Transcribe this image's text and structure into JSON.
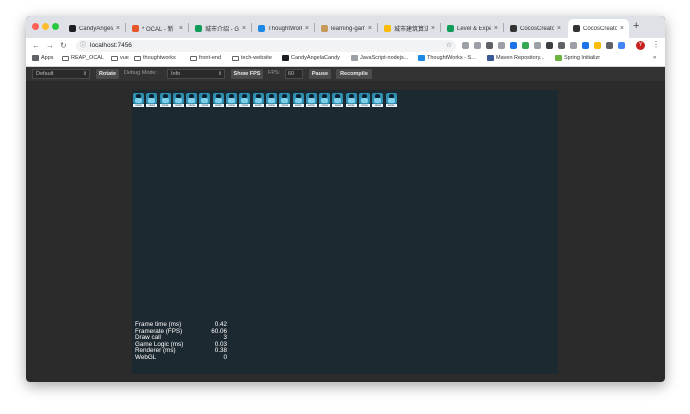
{
  "window": {
    "traffic_lights": {
      "close": "#fe5f57",
      "minimize": "#febc2e",
      "zoom": "#28c840"
    }
  },
  "tabs": [
    {
      "title": "CandyAngela",
      "icon": "github-icon",
      "color": "#1b1f23",
      "active": false
    },
    {
      "title": "* OCAL - 新",
      "icon": "doc-icon",
      "color": "#e8562a",
      "active": false
    },
    {
      "title": "城市介绍 - Gc",
      "icon": "sheets-icon",
      "color": "#0f9d58",
      "active": false
    },
    {
      "title": "ThoughtWork",
      "icon": "thoughtworks-icon",
      "color": "#1e88e5",
      "active": false
    },
    {
      "title": "learning-gam",
      "icon": "avatar-icon",
      "color": "#c79a5b",
      "active": false
    },
    {
      "title": "城市建筑算法",
      "icon": "drive-icon",
      "color": "#fbbc04",
      "active": false
    },
    {
      "title": "Level & Expe",
      "icon": "sheets-icon",
      "color": "#0f9d58",
      "active": false
    },
    {
      "title": "CocosCreato",
      "icon": "cocos-icon",
      "color": "#333333",
      "active": false
    },
    {
      "title": "CocosCreato",
      "icon": "cocos-icon",
      "color": "#333333",
      "active": true
    }
  ],
  "toolbar": {
    "url": "localhost:7456",
    "info_icon": "info-icon",
    "star_icon": "star-icon",
    "profile_initial": "Y",
    "extension_colors": [
      "#9aa0a6",
      "#9aa0a6",
      "#5f6368",
      "#9aa0a6",
      "#1a73e8",
      "#34a853",
      "#9aa0a6",
      "#3c4043",
      "#5f6368",
      "#9aa0a6",
      "#1a73e8",
      "#fbbc04",
      "#5f6368",
      "#4285f4"
    ]
  },
  "bookmarks": [
    {
      "label": "Apps",
      "icon": "apps-grid-icon"
    },
    {
      "label": "REAP_OCAL",
      "icon": "folder-icon"
    },
    {
      "label": "vue",
      "icon": "folder-icon"
    },
    {
      "label": "thoughtworks",
      "icon": "folder-icon"
    },
    {
      "label": "front-end",
      "icon": "folder-icon"
    },
    {
      "label": "tech-website",
      "icon": "folder-icon"
    },
    {
      "label": "CandyAngelaCandy",
      "icon": "github-icon"
    },
    {
      "label": "JavaScript-nodejs...",
      "icon": "page-icon"
    },
    {
      "label": "ThoughtWorks - S...",
      "icon": "thoughtworks-icon"
    },
    {
      "label": "Maven Repository...",
      "icon": "maven-icon"
    },
    {
      "label": "Spring Initializr",
      "icon": "spring-icon"
    }
  ],
  "bookmarks_more": "»",
  "cocos": {
    "device_select": "Default",
    "rotate_label": "Rotate",
    "debug_mode_label": "Debug Mode:",
    "debug_mode_value": "Info",
    "show_fps_label": "Show FPS",
    "fps_label": "FPS:",
    "fps_value": "60",
    "pause_label": "Pause",
    "recompile_label": "Recompile"
  },
  "canvas": {
    "background": "#1d2930",
    "sprite_count": 20,
    "sprite_caption": "cocos"
  },
  "stats": [
    {
      "label": "Frame time (ms)",
      "value": "0.42"
    },
    {
      "label": "Framerate (FPS)",
      "value": "60.06"
    },
    {
      "label": "Draw call",
      "value": "3"
    },
    {
      "label": "Game Logic (ms)",
      "value": "0.03"
    },
    {
      "label": "Renderer (ms)",
      "value": "0.38"
    },
    {
      "label": "WebGL",
      "value": "0"
    }
  ]
}
